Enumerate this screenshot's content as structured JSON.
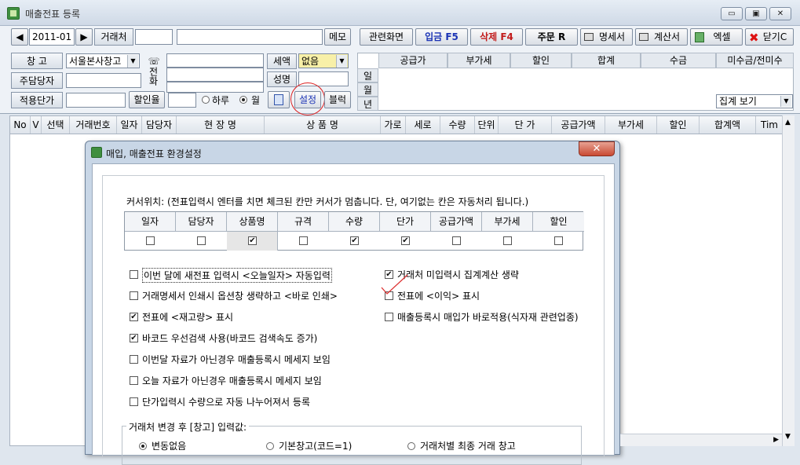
{
  "window": {
    "title": "매출전표 등록",
    "min": "▭",
    "max": "▣",
    "close": "✕"
  },
  "toolbar": {
    "prev": "◀",
    "date": "2011-01",
    "next": "▶",
    "customer_label": "거래처",
    "customer_code": "",
    "customer_name": "",
    "memo": "메모",
    "related": "관련화면",
    "receive": "입금 F5",
    "delete": "삭제 F4",
    "order": "주문 R",
    "statement": "명세서",
    "invoice": "계산서",
    "excel": "엑셀",
    "close": "닫기C"
  },
  "left_panel": {
    "warehouse_label": "창      고",
    "warehouse_value": "서울본사창고",
    "manager_label": "주담당자",
    "manager_value": "",
    "price_label": "적용단가",
    "price_value": "",
    "phone_label": "전화",
    "tax_label": "세액",
    "tax_value": "없음",
    "desc_label": "성명",
    "discount_label": "할인율",
    "discount_value": "",
    "day_label": "하루",
    "month_label": "월",
    "settings_label": "설정",
    "block_label": "블럭"
  },
  "summary": {
    "headers": [
      "공급가",
      "부가세",
      "할인",
      "합계",
      "수금",
      "미수금/전미수"
    ],
    "rows": [
      "일",
      "월",
      "년"
    ],
    "view_select": "집계 보기"
  },
  "table": {
    "headers": [
      "No",
      "V",
      "선택",
      "거래번호",
      "일자",
      "담당자",
      "현 장 명",
      "상 품 명",
      "가로",
      "세로",
      "수량",
      "단위",
      "단 가",
      "공급가액",
      "부가세",
      "할인",
      "합계액",
      "Tim"
    ]
  },
  "dialog": {
    "title": "매입, 매출전표 환경설정",
    "cursor_note": "커서위치: (전표입력시 엔터를 치면 체크된 칸만 커서가 멈춥니다. 단, 여기없는 칸은 자동처리 됩니다.)",
    "cursor_columns": [
      {
        "label": "일자",
        "checked": false
      },
      {
        "label": "담당자",
        "checked": false
      },
      {
        "label": "상품명",
        "checked": true
      },
      {
        "label": "규격",
        "checked": false
      },
      {
        "label": "수량",
        "checked": true
      },
      {
        "label": "단가",
        "checked": true
      },
      {
        "label": "공급가액",
        "checked": false
      },
      {
        "label": "부가세",
        "checked": false
      },
      {
        "label": "할인",
        "checked": false
      }
    ],
    "options_left": [
      {
        "label": "이번 달에 새전표 입력시 <오늘일자> 자동입력",
        "checked": false
      },
      {
        "label": "거래명세서 인쇄시 옵션창 생략하고 <바로 인쇄>",
        "checked": false
      },
      {
        "label": "전표에 <재고량> 표시",
        "checked": true
      },
      {
        "label": "바코드 우선검색 사용(바코드 검색속도 증가)",
        "checked": true
      },
      {
        "label": "이번달 자료가 아닌경우 매출등록시 메세지 보임",
        "checked": false
      },
      {
        "label": "오늘 자료가 아닌경우 매출등록시 메세지 보임",
        "checked": false
      },
      {
        "label": "단가입력시 수량으로 자동 나누어져서 등록",
        "checked": false
      }
    ],
    "options_right": [
      {
        "label": "거래처 미입력시 집계계산 생략",
        "checked": true
      },
      {
        "label": "전표에 <이익> 표시",
        "checked": false
      },
      {
        "label": "매출등록시 매입가 바로적용(식자재 관련업종)",
        "checked": false
      }
    ],
    "group_label": "거래처 변경 후 [창고] 입력값:",
    "radios": [
      {
        "label": "변동없음",
        "selected": true
      },
      {
        "label": "기본창고(코드=1)",
        "selected": false
      },
      {
        "label": "거래처별 최종 거래 창고",
        "selected": false
      }
    ],
    "close": "✕"
  }
}
